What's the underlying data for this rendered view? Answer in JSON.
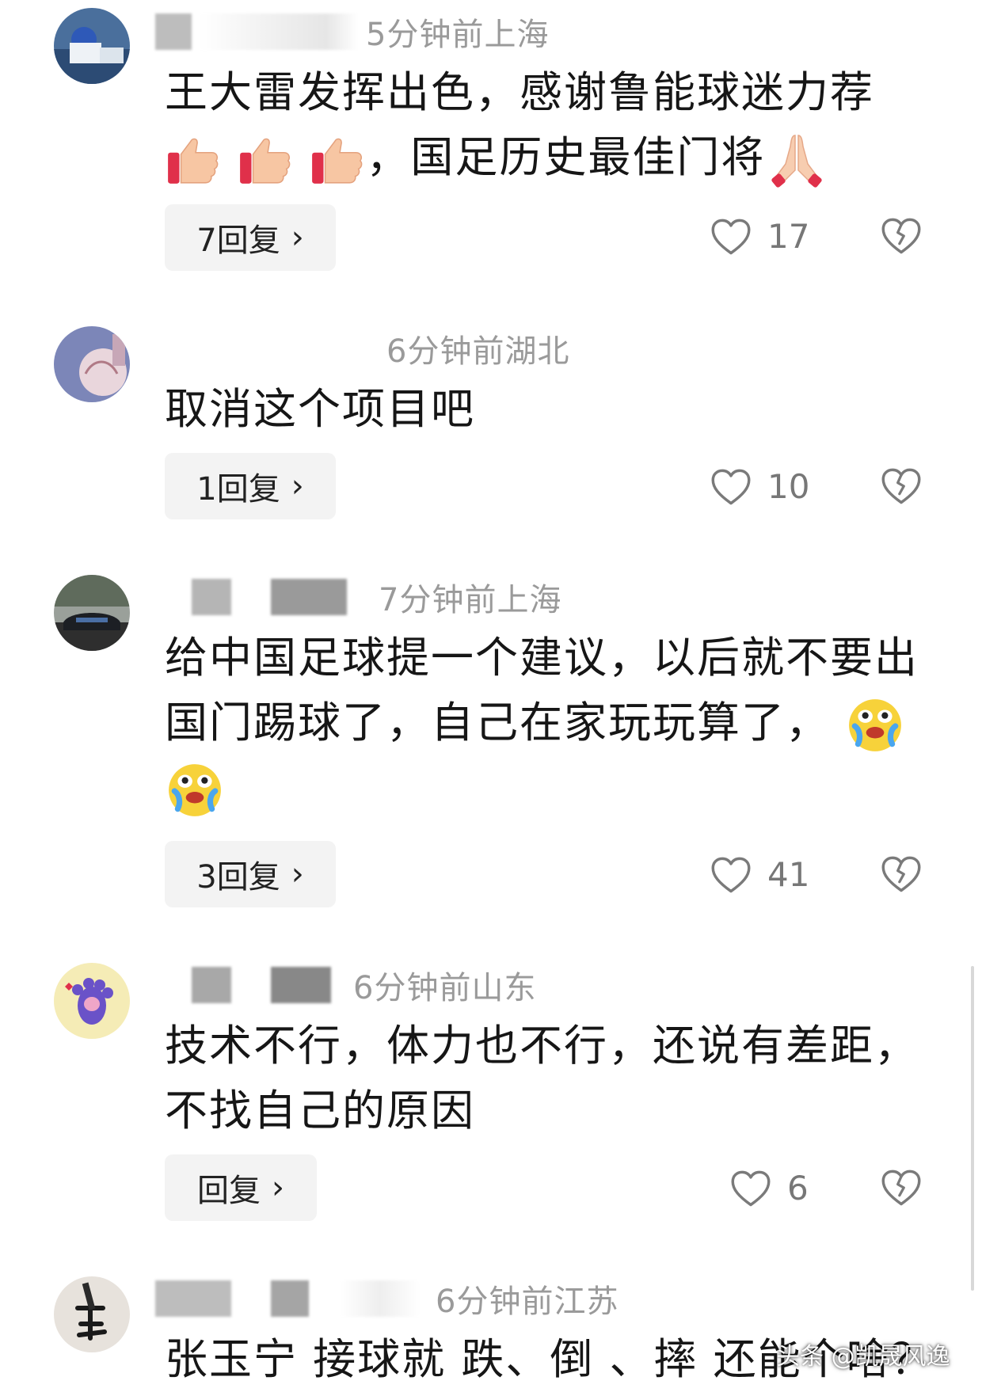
{
  "comments": [
    {
      "time": "5分钟前",
      "location": "上海",
      "text_lines": [
        "王大雷发挥出色，感谢鲁能球迷力荐",
        "，国足历史最佳门将"
      ],
      "reply_label": "7回复",
      "like_count": "17"
    },
    {
      "time": "6分钟前",
      "location": "湖北",
      "text_lines": [
        "取消这个项目吧"
      ],
      "reply_label": "1回复",
      "like_count": "10"
    },
    {
      "time": "7分钟前",
      "location": "上海",
      "text_lines": [
        "给中国足球提一个建议，以后就不要出",
        "国门踢球了，自己在家玩玩算了，"
      ],
      "reply_label": "3回复",
      "like_count": "41"
    },
    {
      "time": "6分钟前",
      "location": "山东",
      "text_lines": [
        "技术不行，体力也不行，还说有差距，",
        "不找自己的原因"
      ],
      "reply_label": "回复",
      "like_count": "6"
    },
    {
      "time": "6分钟前",
      "location": "江苏",
      "text_lines": [
        "张玉宁 接球就 跌、倒 、摔 还能个啥？"
      ]
    }
  ],
  "icons": {
    "like": "heart-outline-icon",
    "dislike": "broken-heart-icon",
    "reply_chevron": "chevron-right-icon",
    "emoji_thumbs": "thumbs-up-emoji",
    "emoji_pray": "praying-hands-emoji",
    "emoji_cry": "crying-face-emoji"
  },
  "watermark": "头条 @凯晟风逸",
  "colors": {
    "meta": "#9a9a9a",
    "text": "#161616",
    "reply_bg": "#f3f3f3"
  }
}
